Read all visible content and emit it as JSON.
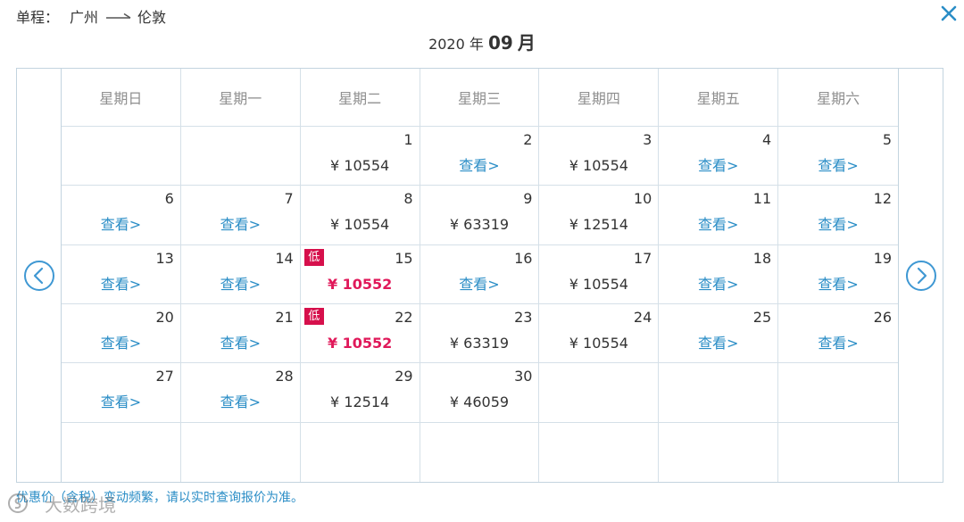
{
  "route": {
    "type_label": "单程：",
    "origin": "广州",
    "destination": "伦敦"
  },
  "icons": {
    "route_arrow": "route-arrow-icon",
    "close": "close-icon",
    "prev": "chevron-left-circle-icon",
    "next": "chevron-right-circle-icon",
    "watermark_logo": "watermark-logo-icon"
  },
  "month_title": {
    "year": "2020",
    "year_unit": "年",
    "month": "09",
    "month_unit": "月"
  },
  "weekdays": [
    "星期日",
    "星期一",
    "星期二",
    "星期三",
    "星期四",
    "星期五",
    "星期六"
  ],
  "view_label": "查看>",
  "low_badge_label": "低",
  "weeks": [
    [
      {},
      {},
      {
        "day": "1",
        "price": "¥ 10554"
      },
      {
        "day": "2"
      },
      {
        "day": "3",
        "price": "¥ 10554"
      },
      {
        "day": "4"
      },
      {
        "day": "5"
      }
    ],
    [
      {
        "day": "6"
      },
      {
        "day": "7"
      },
      {
        "day": "8",
        "price": "¥ 10554"
      },
      {
        "day": "9",
        "price": "¥ 63319"
      },
      {
        "day": "10",
        "price": "¥ 12514"
      },
      {
        "day": "11"
      },
      {
        "day": "12"
      }
    ],
    [
      {
        "day": "13"
      },
      {
        "day": "14"
      },
      {
        "day": "15",
        "price": "¥ 10552",
        "lowest": true
      },
      {
        "day": "16"
      },
      {
        "day": "17",
        "price": "¥ 10554"
      },
      {
        "day": "18"
      },
      {
        "day": "19"
      }
    ],
    [
      {
        "day": "20"
      },
      {
        "day": "21"
      },
      {
        "day": "22",
        "price": "¥ 10552",
        "lowest": true
      },
      {
        "day": "23",
        "price": "¥ 63319"
      },
      {
        "day": "24",
        "price": "¥ 10554"
      },
      {
        "day": "25"
      },
      {
        "day": "26"
      }
    ],
    [
      {
        "day": "27"
      },
      {
        "day": "28"
      },
      {
        "day": "29",
        "price": "¥ 12514"
      },
      {
        "day": "30",
        "price": "¥ 46059"
      },
      {},
      {},
      {}
    ],
    [
      {},
      {},
      {},
      {},
      {},
      {},
      {}
    ]
  ],
  "note": "优惠价（含税）变动频繁，请以实时查询报价为准。",
  "watermark": "大数跨境",
  "colors": {
    "link": "#2a8dc6",
    "low_price": "#e0195a",
    "low_badge_bg": "#d6104c",
    "text": "#333333",
    "weekday": "#8f8f8f",
    "grid_line": "#d5e0e8",
    "frame": "#c3d4df"
  }
}
